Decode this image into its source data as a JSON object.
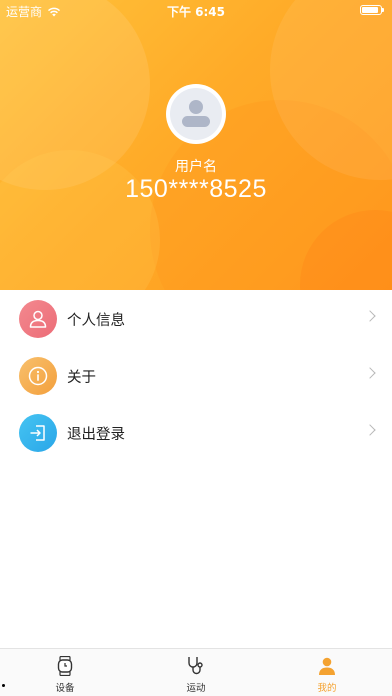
{
  "status_bar": {
    "carrier": "运营商",
    "time": "下午 6:45"
  },
  "profile": {
    "username": "用户名",
    "phone": "150****8525"
  },
  "menu": {
    "items": [
      {
        "label": "个人信息",
        "icon": "person-icon",
        "color": "#ec6c77"
      },
      {
        "label": "关于",
        "icon": "info-icon",
        "color": "#f39f3c"
      },
      {
        "label": "退出登录",
        "icon": "logout-icon",
        "color": "#2aa6e8"
      }
    ]
  },
  "tab_bar": {
    "tabs": [
      {
        "label": "设备",
        "icon": "watch-icon",
        "active": false
      },
      {
        "label": "运动",
        "icon": "stethoscope-icon",
        "active": false
      },
      {
        "label": "我的",
        "icon": "user-icon",
        "active": true
      }
    ]
  },
  "colors": {
    "header_start": "#ffc23a",
    "header_end": "#ff9a1e",
    "accent": "#f4a230"
  }
}
